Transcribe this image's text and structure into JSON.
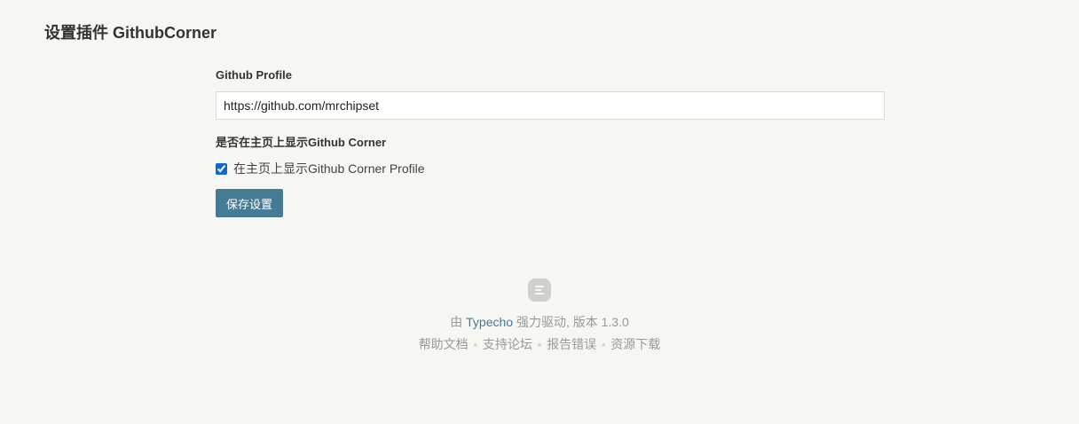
{
  "page": {
    "title": "设置插件 GithubCorner"
  },
  "form": {
    "profile_label": "Github Profile",
    "profile_value": "https://github.com/mrchipset",
    "corner_label": "是否在主页上显示Github Corner",
    "checkbox_label": "在主页上显示Github Corner Profile",
    "checkbox_checked": true,
    "save_label": "保存设置"
  },
  "footer": {
    "logo_icon": "typecho-logo-icon",
    "powered_prefix": "由 ",
    "powered_link": "Typecho",
    "powered_suffix": " 强力驱动, 版本 1.3.0",
    "links": [
      "帮助文档",
      "支持论坛",
      "报告错误",
      "资源下载"
    ],
    "separator": "•"
  },
  "colors": {
    "background": "#f6f6f3",
    "accent": "#467b96",
    "checkbox": "#0b6bd3"
  }
}
